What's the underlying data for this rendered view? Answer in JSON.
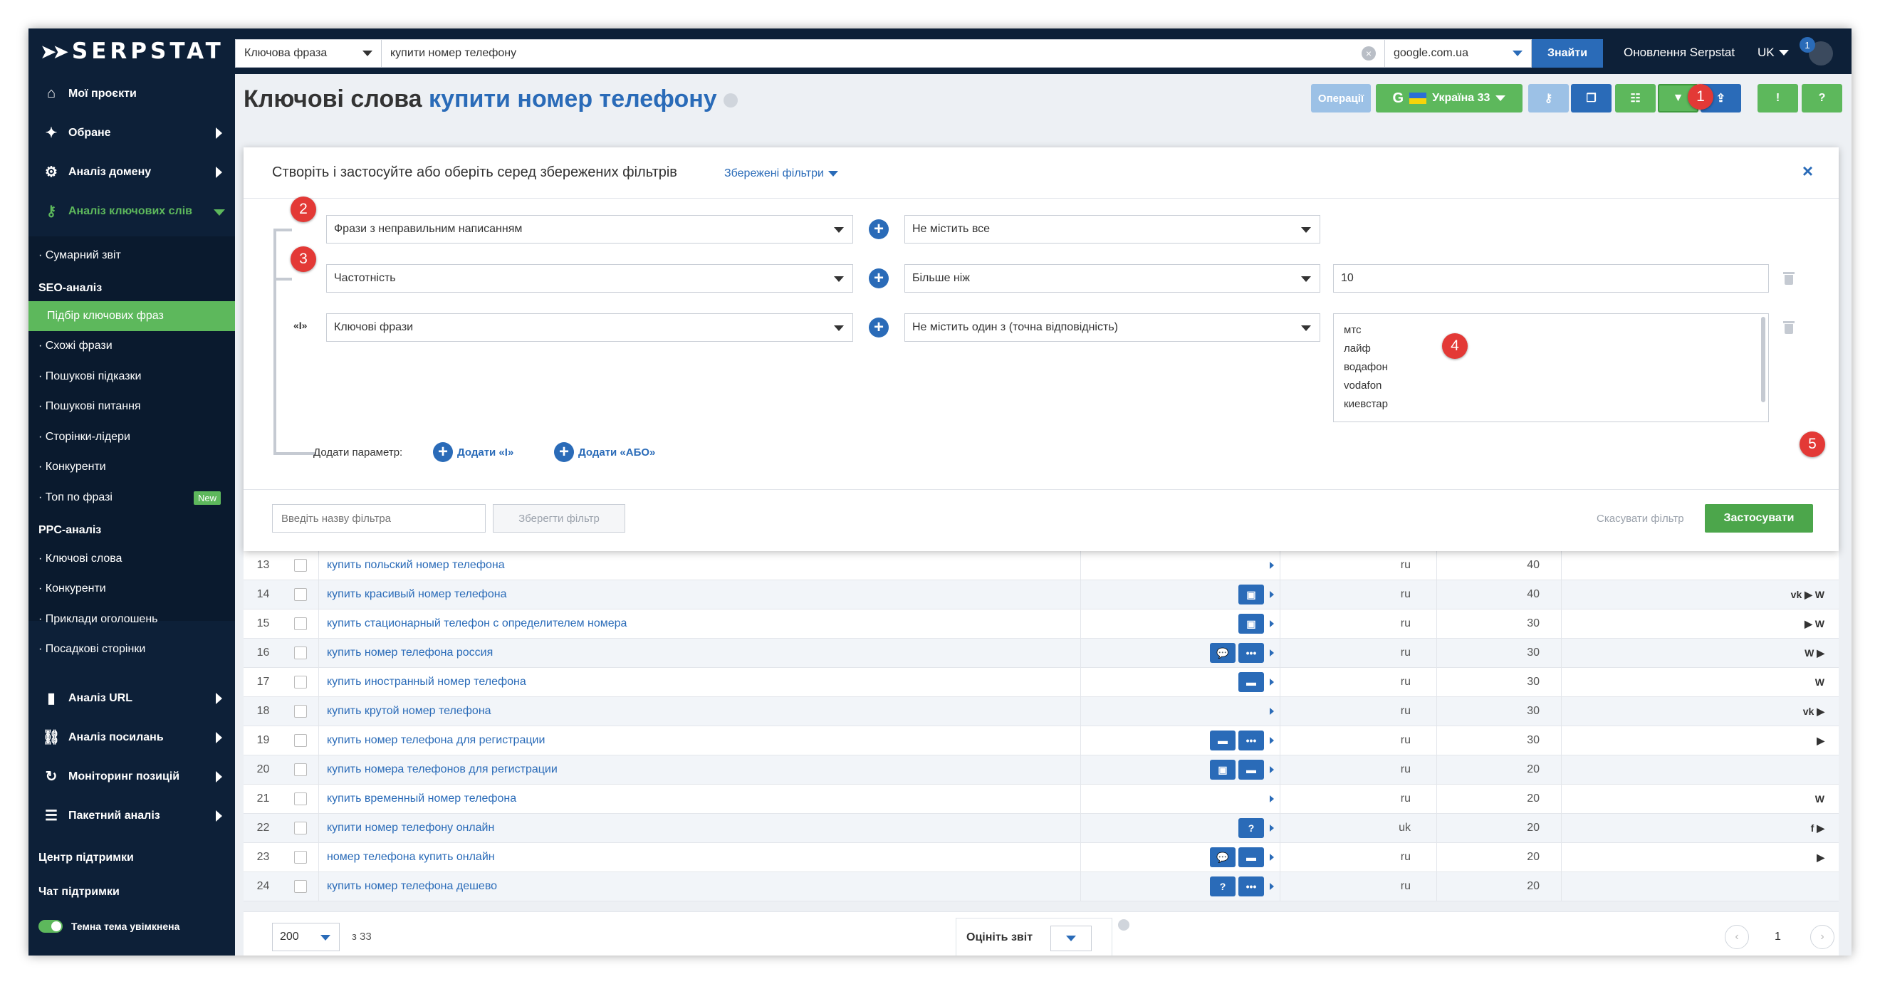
{
  "topbar": {
    "logo": "SERPSTAT",
    "search_type": "Ключова фраза",
    "query": "купити номер телефону",
    "engine": "google.com.ua",
    "search_button": "Знайти",
    "updates": "Оновлення Serpstat",
    "lang": "UK",
    "notif_count": "1"
  },
  "sidebar": {
    "main_items": [
      {
        "label": "Мої проєкти"
      },
      {
        "label": "Обране"
      },
      {
        "label": "Аналіз домену"
      },
      {
        "label": "Аналіз ключових слів"
      }
    ],
    "sub_summary": "· Сумарний звіт",
    "seo_section": "SEO-аналіз",
    "seo_items": [
      "Підбір ключових фраз",
      "· Схожі фрази",
      "· Пошукові підказки",
      "· Пошукові питання",
      "· Сторінки-лідери",
      "· Конкуренти",
      "· Топ по фразі"
    ],
    "new_badge": "New",
    "ppc_section": "PPC-аналіз",
    "ppc_items": [
      "· Ключові слова",
      "· Конкуренти",
      "· Приклади оголошень",
      "· Посадкові сторінки"
    ],
    "bottom_items": [
      {
        "label": "Аналіз URL"
      },
      {
        "label": "Аналіз посилань"
      },
      {
        "label": "Моніторинг позицій"
      },
      {
        "label": "Пакетний аналіз"
      }
    ],
    "support_center": "Центр підтримки",
    "support_chat": "Чат підтримки",
    "dark_theme": "Темна тема увімкнена"
  },
  "header": {
    "title": "Ключові слова",
    "keyword": "купити номер телефону",
    "operations": "Операції",
    "region": "Україна 33"
  },
  "filter_panel": {
    "heading": "Створіть і застосуйте або оберіть серед збережених фільтрів",
    "saved_filters": "Збережені фільтри",
    "close": "×",
    "rows": [
      {
        "param": "Фрази з неправильним написанням",
        "condition": "Не містить все",
        "value": ""
      },
      {
        "param": "Частотність",
        "condition": "Більше ніж",
        "value": "10"
      },
      {
        "param": "Ключові фрази",
        "condition": "Не містить один з (точна відповідність)",
        "values": [
          "мтс",
          "лайф",
          "водафон",
          "vodafon",
          "киевстар"
        ]
      }
    ],
    "and_marker": "«І»",
    "add_param_label": "Додати параметр:",
    "add_and": "Додати «І»",
    "add_or": "Додати «АБО»",
    "name_placeholder": "Введіть назву фільтра",
    "save_filter": "Зберегти фільтр",
    "cancel": "Скасувати фільтр",
    "apply": "Застосувати"
  },
  "callouts": [
    "1",
    "2",
    "3",
    "4",
    "5"
  ],
  "table": {
    "rows": [
      {
        "n": "13",
        "kw": "купить польский номер телефона",
        "feat": [],
        "lang": "ru",
        "vol": "40",
        "soc": ""
      },
      {
        "n": "14",
        "kw": "купить красивый номер телефона",
        "feat": [
          "img"
        ],
        "lang": "ru",
        "vol": "40",
        "soc": "vk ▶ W"
      },
      {
        "n": "15",
        "kw": "купить стационарный телефон с определителем номера",
        "feat": [
          "img"
        ],
        "lang": "ru",
        "vol": "30",
        "soc": "▶ W"
      },
      {
        "n": "16",
        "kw": "купить номер телефона россия",
        "feat": [
          "chat",
          "dots"
        ],
        "lang": "ru",
        "vol": "30",
        "soc": "W ▶"
      },
      {
        "n": "17",
        "kw": "купить иностранный номер телефона",
        "feat": [
          "card"
        ],
        "lang": "ru",
        "vol": "30",
        "soc": "W"
      },
      {
        "n": "18",
        "kw": "купить крутой номер телефона",
        "feat": [],
        "lang": "ru",
        "vol": "30",
        "soc": "vk ▶"
      },
      {
        "n": "19",
        "kw": "купить номер телефона для регистрации",
        "feat": [
          "card",
          "dots"
        ],
        "lang": "ru",
        "vol": "30",
        "soc": "▶"
      },
      {
        "n": "20",
        "kw": "купить номера телефонов для регистрации",
        "feat": [
          "img",
          "card"
        ],
        "lang": "ru",
        "vol": "20",
        "soc": ""
      },
      {
        "n": "21",
        "kw": "купить временный номер телефона",
        "feat": [],
        "lang": "ru",
        "vol": "20",
        "soc": "W"
      },
      {
        "n": "22",
        "kw": "купити номер телефону онлайн",
        "feat": [
          "q"
        ],
        "lang": "uk",
        "vol": "20",
        "soc": "f ▶"
      },
      {
        "n": "23",
        "kw": "номер телефона купить онлайн",
        "feat": [
          "chat",
          "card"
        ],
        "lang": "ru",
        "vol": "20",
        "soc": "▶"
      },
      {
        "n": "24",
        "kw": "купить номер телефона дешево",
        "feat": [
          "q",
          "dots"
        ],
        "lang": "ru",
        "vol": "20",
        "soc": ""
      }
    ]
  },
  "pager": {
    "per_page": "200",
    "of_total": "з 33",
    "rate_report": "Оцініть звіт",
    "page": "1"
  },
  "colors": {
    "navy": "#0d2038",
    "blue": "#2a6bb8",
    "green": "#5db85c",
    "red": "#e33936"
  }
}
